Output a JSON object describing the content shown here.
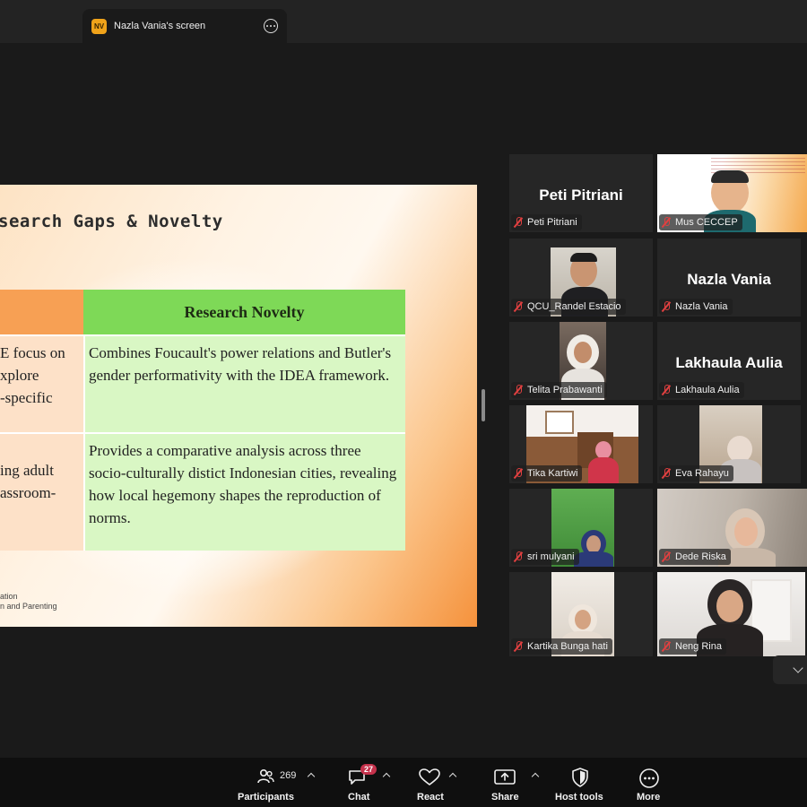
{
  "screen_tab": {
    "initials": "NV",
    "label": "Nazla Vania's screen"
  },
  "slide": {
    "title": "search Gaps & Novelty",
    "table": {
      "header_right": "Research Novelty",
      "rows": [
        {
          "left_lines": [
            "E focus on",
            "xplore",
            "-specific"
          ],
          "right": "Combines Foucault's power relations and Butler's gender performativity with the IDEA framework."
        },
        {
          "left_lines": [
            "ing adult",
            "assroom-"
          ],
          "right": "Provides a comparative analysis across three socio-culturally distict Indonesian cities, revealing how local hegemony shapes the reproduction of norms."
        }
      ]
    },
    "footer_lines": [
      "ation",
      "n and Parenting"
    ]
  },
  "participants": [
    {
      "tag": "Peti Pitriani",
      "big": "Peti Pitriani"
    },
    {
      "tag": "Mus CECCEP",
      "big": ""
    },
    {
      "tag": "QCU_Randel Estacio",
      "big": ""
    },
    {
      "tag": "Nazla Vania",
      "big": "Nazla Vania"
    },
    {
      "tag": "Telita Prabawanti",
      "big": ""
    },
    {
      "tag": "Lakhaula Aulia",
      "big": "Lakhaula Aulia"
    },
    {
      "tag": "Tika Kartiwi",
      "big": ""
    },
    {
      "tag": "Eva Rahayu",
      "big": ""
    },
    {
      "tag": "sri mulyani",
      "big": ""
    },
    {
      "tag": "Dede Riska",
      "big": ""
    },
    {
      "tag": "Kartika Bunga hati",
      "big": ""
    },
    {
      "tag": "Neng Rina",
      "big": ""
    }
  ],
  "toolbar": {
    "participants_label": "Participants",
    "participants_count": "269",
    "chat_label": "Chat",
    "chat_badge": "27",
    "react_label": "React",
    "share_label": "Share",
    "host_tools_label": "Host tools",
    "more_label": "More"
  }
}
